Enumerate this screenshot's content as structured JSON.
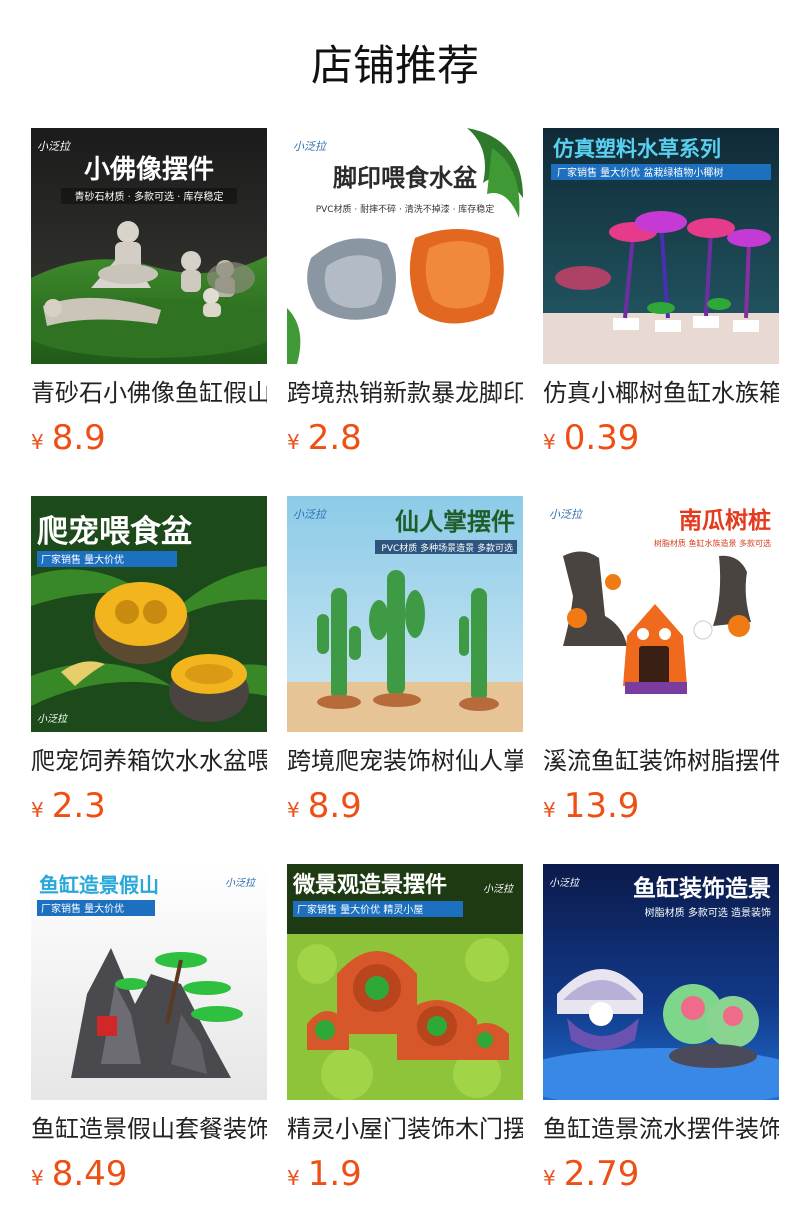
{
  "header": {
    "title": "店铺推荐"
  },
  "colors": {
    "price": "#ee4f14",
    "title": "#111111",
    "name": "#222222"
  },
  "products": [
    {
      "name": "青砂石小佛像鱼缸假山装饰",
      "currency": "¥",
      "price": "8.9",
      "image": {
        "brand": "小泛拉",
        "title": "小佛像摆件",
        "subtitle": "青砂石材质 · 多款可选 · 库存稳定"
      }
    },
    {
      "name": "跨境热销新款暴龙脚印喂食水盆",
      "currency": "¥",
      "price": "2.8",
      "image": {
        "brand": "小泛拉",
        "title": "脚印喂食水盆",
        "subtitle": "PVC材质 · 耐摔不碎 · 清洗不掉漆 · 库存稳定"
      }
    },
    {
      "name": "仿真小椰树鱼缸水族箱造景",
      "currency": "¥",
      "price": "0.39",
      "image": {
        "title": "仿真塑料水草系列",
        "subtitle": "厂家销售  量大价优  盆栽绿植物小椰树"
      }
    },
    {
      "name": "爬宠饲养箱饮水水盆喂食盆",
      "currency": "¥",
      "price": "2.3",
      "image": {
        "brand": "小泛拉",
        "title": "爬宠喂食盆",
        "subtitle": "厂家销售  量大价优"
      }
    },
    {
      "name": "跨境爬宠装饰树仙人掌摆件",
      "currency": "¥",
      "price": "8.9",
      "image": {
        "brand": "小泛拉",
        "title": "仙人掌摆件",
        "subtitle": "PVC材质  多种场景造景  多款可选"
      }
    },
    {
      "name": "溪流鱼缸装饰树脂摆件南瓜",
      "currency": "¥",
      "price": "13.9",
      "image": {
        "brand": "小泛拉",
        "title": "南瓜树桩",
        "subtitle": "树脂材质  鱼缸水族造景  多款可选"
      }
    },
    {
      "name": "鱼缸造景假山套餐装饰摆件",
      "currency": "¥",
      "price": "8.49",
      "image": {
        "brand": "小泛拉",
        "title": "鱼缸造景假山",
        "subtitle": "厂家销售  量大价优"
      }
    },
    {
      "name": "精灵小屋门装饰木门摆件",
      "currency": "¥",
      "price": "1.9",
      "image": {
        "brand": "小泛拉",
        "title": "微景观造景摆件",
        "subtitle": "厂家销售  量大价优  精灵小屋"
      }
    },
    {
      "name": "鱼缸造景流水摆件装饰贝壳",
      "currency": "¥",
      "price": "2.79",
      "image": {
        "brand": "小泛拉",
        "title": "鱼缸装饰造景",
        "subtitle": "树脂材质  多款可选  造景装饰"
      }
    }
  ]
}
